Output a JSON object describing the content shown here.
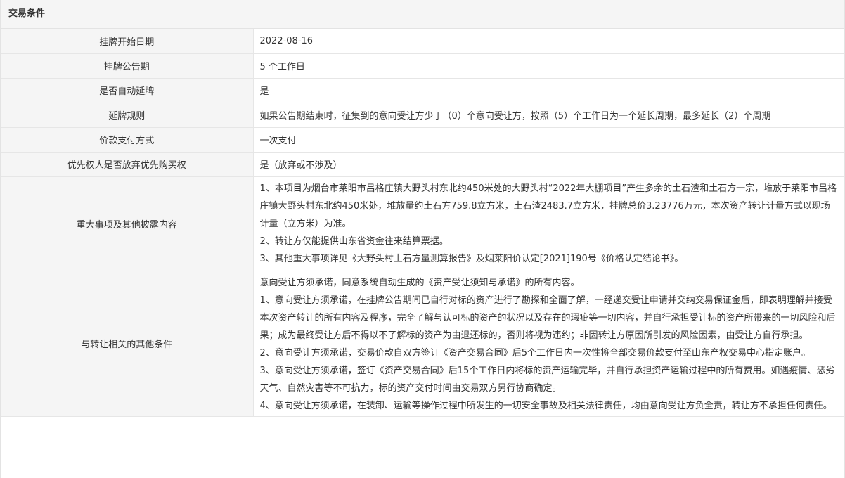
{
  "section_title": "交易条件",
  "rows": [
    {
      "label": "挂牌开始日期",
      "value": "2022-08-16"
    },
    {
      "label": "挂牌公告期",
      "value": "5 个工作日"
    },
    {
      "label": "是否自动延牌",
      "value": "是"
    },
    {
      "label": "延牌规则",
      "value": "如果公告期结束时，征集到的意向受让方少于（0）个意向受让方，按照（5）个工作日为一个延长周期，最多延长（2）个周期"
    },
    {
      "label": "价款支付方式",
      "value": "一次支付"
    },
    {
      "label": "优先权人是否放弃优先购买权",
      "value": "是（放弃或不涉及）"
    }
  ],
  "disclosure": {
    "label": "重大事项及其他披露内容",
    "paragraphs": [
      "1、本项目为烟台市莱阳市吕格庄镇大野头村东北约450米处的大野头村“2022年大棚项目”产生多余的土石渣和土石方一宗，堆放于莱阳市吕格庄镇大野头村东北约450米处，堆放量约土石方759.8立方米，土石渣2483.7立方米，挂牌总价3.23776万元，本次资产转让计量方式以现场计量（立方米）为准。",
      "2、转让方仅能提供山东省资金往来结算票据。",
      "3、其他重大事项详见《大野头村土石方量测算报告》及烟莱阳价认定[2021]190号《价格认定结论书》。"
    ]
  },
  "other_conditions": {
    "label": "与转让相关的其他条件",
    "paragraphs": [
      "意向受让方须承诺，同意系统自动生成的《资产受让须知与承诺》的所有内容。",
      "1、意向受让方须承诺，在挂牌公告期间已自行对标的资产进行了勘探和全面了解，一经递交受让申请并交纳交易保证金后，即表明理解并接受本次资产转让的所有内容及程序，完全了解与认可标的资产的状况以及存在的瑕疵等一切内容，并自行承担受让标的资产所带来的一切风险和后果；成为最终受让方后不得以不了解标的资产为由退还标的，否则将视为违约；非因转让方原因所引发的风险因素，由受让方自行承担。",
      "2、意向受让方须承诺，交易价款自双方签订《资产交易合同》后5个工作日内一次性将全部交易价款支付至山东产权交易中心指定账户。",
      "3、意向受让方须承诺，签订《资产交易合同》后15个工作日内将标的资产运输完毕，并自行承担资产运输过程中的所有费用。如遇疫情、恶劣天气、自然灾害等不可抗力，标的资产交付时间由交易双方另行协商确定。",
      "4、意向受让方须承诺，在装卸、运输等操作过程中所发生的一切安全事故及相关法律责任，均由意向受让方负全责，转让方不承担任何责任。"
    ]
  }
}
